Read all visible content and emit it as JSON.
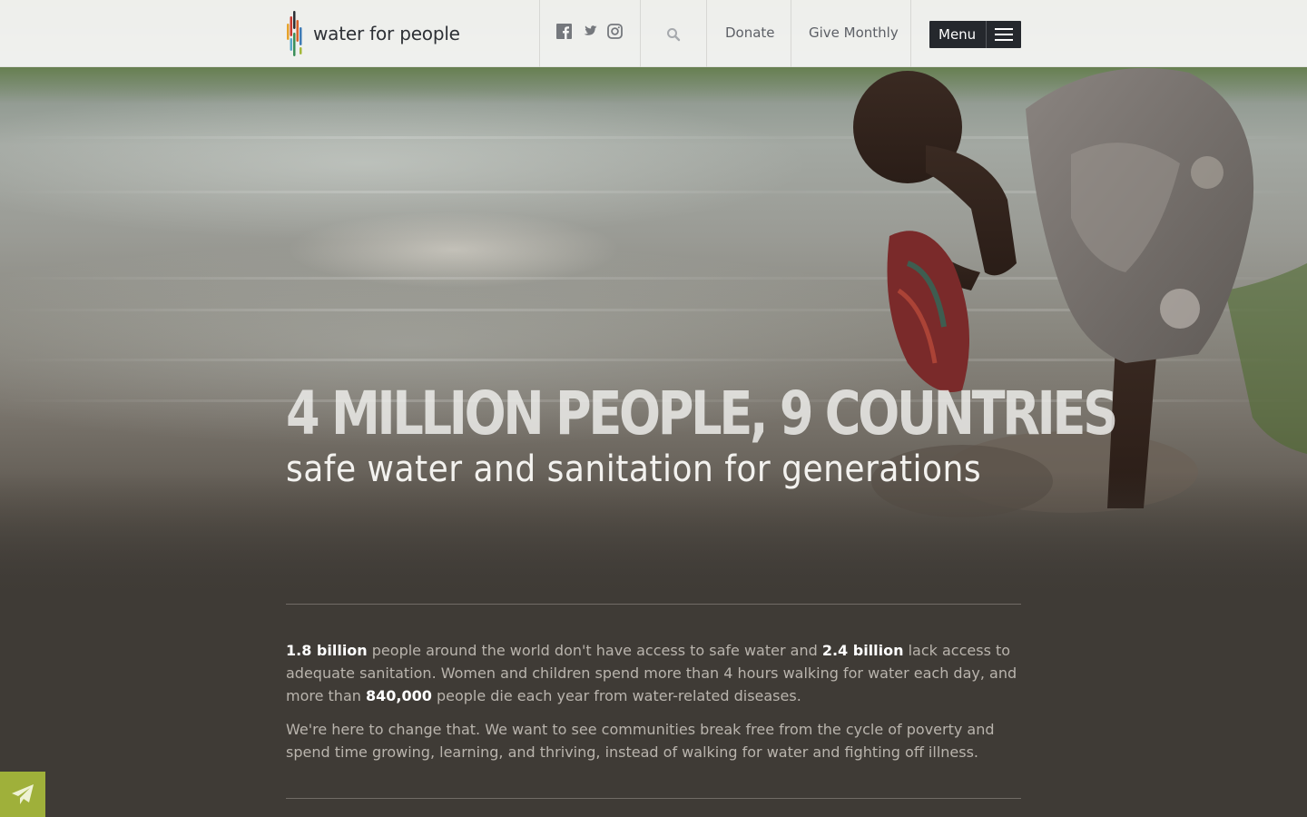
{
  "header": {
    "logo_text": "water for people",
    "social": [
      "facebook-icon",
      "twitter-icon",
      "instagram-icon"
    ],
    "search_icon": "search-icon",
    "nav": {
      "donate": "Donate",
      "give_monthly": "Give Monthly"
    },
    "menu_label": "Menu"
  },
  "hero": {
    "headline": "4 MILLION PEOPLE, 9 COUNTRIES",
    "subheadline": "safe water and sanitation for generations"
  },
  "intro": {
    "p1": {
      "stat1": "1.8 billion",
      "t1": " people around the world don't have access to safe water and ",
      "stat2": "2.4 billion",
      "t2": " lack access to adequate sanitation. Women and children spend more than 4 hours walking for water each day, and more than ",
      "stat3": "840,000",
      "t3": " people die each year from water-related diseases."
    },
    "p2": "We're here to change that. We want to see communities break free from the cycle of poverty and spend time growing, learning, and thriving, instead of walking for water and fighting off illness."
  },
  "floating_button_icon": "paper-plane-icon",
  "colors": {
    "header_bg": "#f8f8f6",
    "body_bg": "#3f3b36",
    "menu_bg": "#25282d",
    "accent_green": "#9fb03a"
  }
}
